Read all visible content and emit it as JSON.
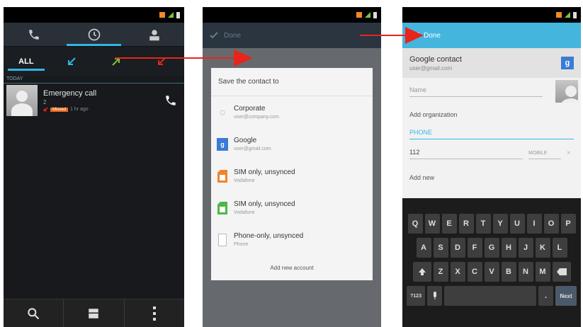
{
  "phone1": {
    "filters": [
      "ALL"
    ],
    "section_label": "TODAY",
    "call_log": [
      {
        "name": "Emergency call",
        "count": "2",
        "badge": "Missed",
        "time": "1 hr ago"
      }
    ]
  },
  "phone2": {
    "action_title": "Done",
    "dialog_title": "Save the contact to",
    "options": [
      {
        "title": "Corporate",
        "sub": "user@company.com",
        "icon": "exchange-icon",
        "color": "#cccccc"
      },
      {
        "title": "Google",
        "sub": "user@gmail.com",
        "icon": "google-icon",
        "color": "#3a7bd5"
      },
      {
        "title": "SIM only, unsynced",
        "sub": "Vodafone",
        "icon": "sim-icon",
        "color": "#f0842a"
      },
      {
        "title": "SIM only, unsynced",
        "sub": "Vodafone",
        "icon": "sim-icon",
        "color": "#4cb848"
      },
      {
        "title": "Phone-only, unsynced",
        "sub": "Phone",
        "icon": "phone-storage-icon",
        "color": "#cfcfcf"
      }
    ],
    "add_account": "Add new account"
  },
  "phone3": {
    "action_title": "Done",
    "account_title": "Google contact",
    "account_sub": "user@gmail.com",
    "account_icon_letter": "g",
    "name_placeholder": "Name",
    "add_organization": "Add organization",
    "phone_section": "PHONE",
    "phone_value": "112",
    "phone_type": "MOBILE",
    "add_another": "Add new",
    "keyboard": {
      "row1": [
        "Q",
        "W",
        "E",
        "R",
        "T",
        "Y",
        "U",
        "I",
        "O",
        "P"
      ],
      "row2": [
        "A",
        "S",
        "D",
        "F",
        "G",
        "H",
        "J",
        "K",
        "L"
      ],
      "row3": [
        "Z",
        "X",
        "C",
        "V",
        "B",
        "N",
        "M"
      ],
      "sym_label": "?123",
      "next_label": "Next"
    }
  },
  "colors": {
    "accent": "#33b5e5",
    "arrow": "#e8241c",
    "missed_badge": "#e86a1e"
  }
}
